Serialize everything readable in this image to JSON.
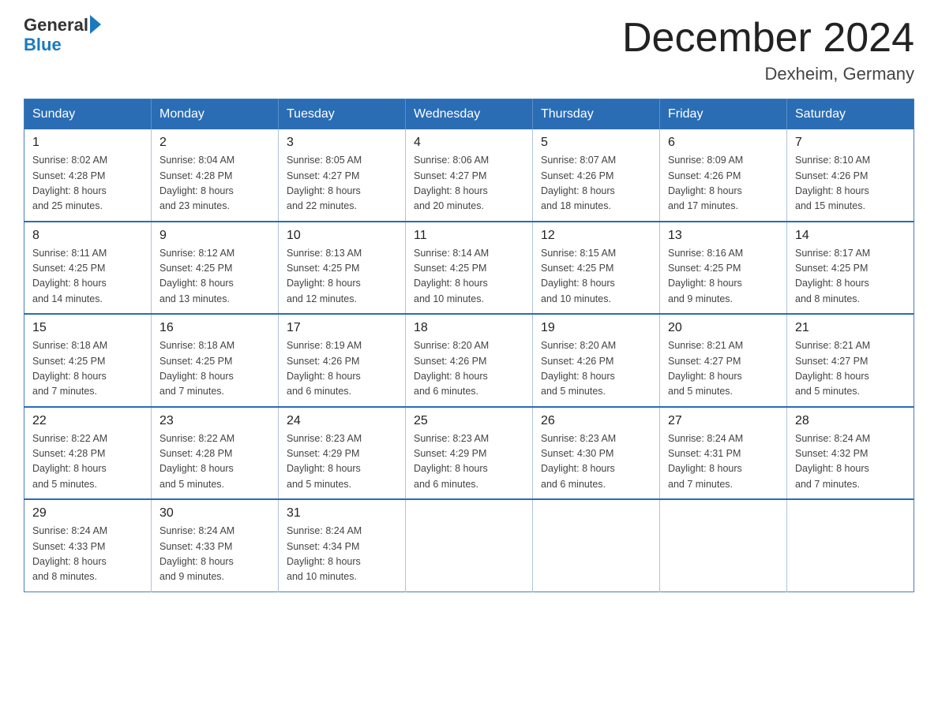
{
  "logo": {
    "general": "General",
    "blue": "Blue"
  },
  "header": {
    "title": "December 2024",
    "subtitle": "Dexheim, Germany"
  },
  "days_of_week": [
    "Sunday",
    "Monday",
    "Tuesday",
    "Wednesday",
    "Thursday",
    "Friday",
    "Saturday"
  ],
  "weeks": [
    [
      {
        "day": "1",
        "sunrise": "8:02 AM",
        "sunset": "4:28 PM",
        "daylight": "8 hours and 25 minutes."
      },
      {
        "day": "2",
        "sunrise": "8:04 AM",
        "sunset": "4:28 PM",
        "daylight": "8 hours and 23 minutes."
      },
      {
        "day": "3",
        "sunrise": "8:05 AM",
        "sunset": "4:27 PM",
        "daylight": "8 hours and 22 minutes."
      },
      {
        "day": "4",
        "sunrise": "8:06 AM",
        "sunset": "4:27 PM",
        "daylight": "8 hours and 20 minutes."
      },
      {
        "day": "5",
        "sunrise": "8:07 AM",
        "sunset": "4:26 PM",
        "daylight": "8 hours and 18 minutes."
      },
      {
        "day": "6",
        "sunrise": "8:09 AM",
        "sunset": "4:26 PM",
        "daylight": "8 hours and 17 minutes."
      },
      {
        "day": "7",
        "sunrise": "8:10 AM",
        "sunset": "4:26 PM",
        "daylight": "8 hours and 15 minutes."
      }
    ],
    [
      {
        "day": "8",
        "sunrise": "8:11 AM",
        "sunset": "4:25 PM",
        "daylight": "8 hours and 14 minutes."
      },
      {
        "day": "9",
        "sunrise": "8:12 AM",
        "sunset": "4:25 PM",
        "daylight": "8 hours and 13 minutes."
      },
      {
        "day": "10",
        "sunrise": "8:13 AM",
        "sunset": "4:25 PM",
        "daylight": "8 hours and 12 minutes."
      },
      {
        "day": "11",
        "sunrise": "8:14 AM",
        "sunset": "4:25 PM",
        "daylight": "8 hours and 10 minutes."
      },
      {
        "day": "12",
        "sunrise": "8:15 AM",
        "sunset": "4:25 PM",
        "daylight": "8 hours and 10 minutes."
      },
      {
        "day": "13",
        "sunrise": "8:16 AM",
        "sunset": "4:25 PM",
        "daylight": "8 hours and 9 minutes."
      },
      {
        "day": "14",
        "sunrise": "8:17 AM",
        "sunset": "4:25 PM",
        "daylight": "8 hours and 8 minutes."
      }
    ],
    [
      {
        "day": "15",
        "sunrise": "8:18 AM",
        "sunset": "4:25 PM",
        "daylight": "8 hours and 7 minutes."
      },
      {
        "day": "16",
        "sunrise": "8:18 AM",
        "sunset": "4:25 PM",
        "daylight": "8 hours and 7 minutes."
      },
      {
        "day": "17",
        "sunrise": "8:19 AM",
        "sunset": "4:26 PM",
        "daylight": "8 hours and 6 minutes."
      },
      {
        "day": "18",
        "sunrise": "8:20 AM",
        "sunset": "4:26 PM",
        "daylight": "8 hours and 6 minutes."
      },
      {
        "day": "19",
        "sunrise": "8:20 AM",
        "sunset": "4:26 PM",
        "daylight": "8 hours and 5 minutes."
      },
      {
        "day": "20",
        "sunrise": "8:21 AM",
        "sunset": "4:27 PM",
        "daylight": "8 hours and 5 minutes."
      },
      {
        "day": "21",
        "sunrise": "8:21 AM",
        "sunset": "4:27 PM",
        "daylight": "8 hours and 5 minutes."
      }
    ],
    [
      {
        "day": "22",
        "sunrise": "8:22 AM",
        "sunset": "4:28 PM",
        "daylight": "8 hours and 5 minutes."
      },
      {
        "day": "23",
        "sunrise": "8:22 AM",
        "sunset": "4:28 PM",
        "daylight": "8 hours and 5 minutes."
      },
      {
        "day": "24",
        "sunrise": "8:23 AM",
        "sunset": "4:29 PM",
        "daylight": "8 hours and 5 minutes."
      },
      {
        "day": "25",
        "sunrise": "8:23 AM",
        "sunset": "4:29 PM",
        "daylight": "8 hours and 6 minutes."
      },
      {
        "day": "26",
        "sunrise": "8:23 AM",
        "sunset": "4:30 PM",
        "daylight": "8 hours and 6 minutes."
      },
      {
        "day": "27",
        "sunrise": "8:24 AM",
        "sunset": "4:31 PM",
        "daylight": "8 hours and 7 minutes."
      },
      {
        "day": "28",
        "sunrise": "8:24 AM",
        "sunset": "4:32 PM",
        "daylight": "8 hours and 7 minutes."
      }
    ],
    [
      {
        "day": "29",
        "sunrise": "8:24 AM",
        "sunset": "4:33 PM",
        "daylight": "8 hours and 8 minutes."
      },
      {
        "day": "30",
        "sunrise": "8:24 AM",
        "sunset": "4:33 PM",
        "daylight": "8 hours and 9 minutes."
      },
      {
        "day": "31",
        "sunrise": "8:24 AM",
        "sunset": "4:34 PM",
        "daylight": "8 hours and 10 minutes."
      },
      null,
      null,
      null,
      null
    ]
  ],
  "labels": {
    "sunrise": "Sunrise:",
    "sunset": "Sunset:",
    "daylight": "Daylight:"
  }
}
